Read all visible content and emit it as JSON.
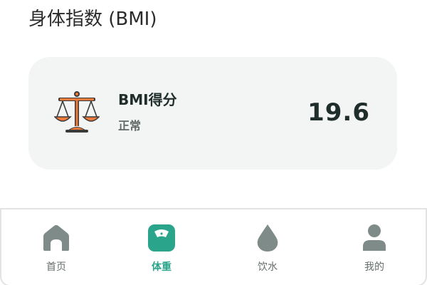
{
  "page": {
    "title": "身体指数 (BMI)"
  },
  "bmi_card": {
    "label": "BMI得分",
    "status": "正常",
    "value": "19.6",
    "icon": "balance-scale-icon"
  },
  "tabbar": {
    "items": [
      {
        "label": "首页",
        "icon": "home-icon",
        "active": false
      },
      {
        "label": "体重",
        "icon": "weight-scale-icon",
        "active": true
      },
      {
        "label": "饮水",
        "icon": "water-drop-icon",
        "active": false
      },
      {
        "label": "我的",
        "icon": "person-icon",
        "active": false
      }
    ]
  },
  "colors": {
    "accent": "#2aa48a",
    "icon_inactive": "#7f8b89",
    "card_bg": "#f3f5f4",
    "scale_orange": "#f07a3a",
    "scale_dark": "#3a3a3a"
  }
}
